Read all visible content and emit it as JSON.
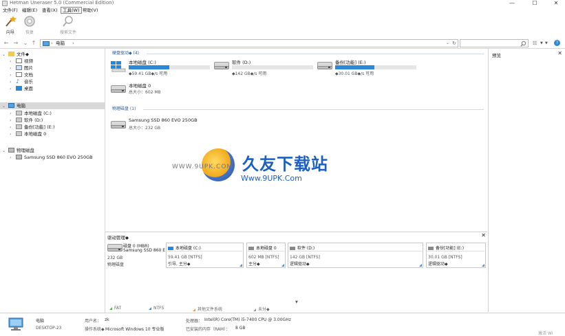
{
  "window": {
    "title": "Hetman Uneraser 5.0 (Commercial Edition)",
    "minimize": "—",
    "maximize": "☐",
    "close": "✕"
  },
  "menu": [
    {
      "label": "文件(F)"
    },
    {
      "label": "编辑(E)"
    },
    {
      "label": "查看(X)"
    },
    {
      "label": "工具(W)",
      "active": true
    },
    {
      "label": "帮助(V)"
    }
  ],
  "toolbar": {
    "wizard": "向导",
    "recover": "恢复",
    "search": "搜索文件"
  },
  "address": {
    "crumb": "电脑",
    "search_icon": "search-icon",
    "refresh": "↻"
  },
  "tree": {
    "files_root": "文件◆",
    "files": [
      "视频",
      "图片",
      "文档",
      "音乐",
      "桌面"
    ],
    "computer_root": "电脑",
    "computer": [
      "本地磁盘 (C:)",
      "软件 (D:)",
      "备份[功能] (E:)",
      "本地磁盘 0"
    ],
    "physical_root": "物理磁盘",
    "physical": [
      "Samsung SSD 860 EVO 250GB"
    ]
  },
  "main": {
    "logical_header": "硬盘驱动◆ (4)",
    "physical_header": "物理磁盘 (1)",
    "drives": [
      {
        "name": "本地磁盘 (C:)",
        "free": "◆59.41 GB◆/s 可用",
        "fill": 0.5
      },
      {
        "name": "软件 (D:)",
        "free": "◆142 GB◆/s 可用",
        "fill": 0.0
      },
      {
        "name": "备份[功能] (E:)",
        "free": "◆30.01 GB◆/s 可用",
        "fill": 0.48
      }
    ],
    "drive0": {
      "name": "本地磁盘 0",
      "size": "总大小：602 MB"
    },
    "physical": {
      "name": "Samsung SSD 860 EVO 250GB",
      "size": "总大小：232 GB"
    }
  },
  "watermark": {
    "big": "久友下载站",
    "url": "Www.9UPK.Com",
    "wurl": "WWW.9UPK.COM"
  },
  "preview": {
    "header": "预览",
    "close": "✕"
  },
  "diskmgmt": {
    "header": "驱动管理◆",
    "close": "✕",
    "disk": {
      "l1": "磁盘 0 (MBR)",
      "l2": "Samsung SSD 860 E",
      "l3": "232 GB",
      "l4": "物理磁盘"
    },
    "parts": [
      {
        "name": "本地磁盘 (C:)",
        "size": "59.41 GB [NTFS]",
        "type": "引导, 主分◆"
      },
      {
        "name": "本地磁盘 0",
        "size": "602 MB [NTFS]",
        "type": "主分◆"
      },
      {
        "name": "软件 (D:)",
        "size": "142 GB [NTFS]",
        "type": "逻辑驱动◆"
      },
      {
        "name": "备份[功能] (E:)",
        "size": "30.01 GB [NTFS]",
        "type": "逻辑驱动◆"
      }
    ],
    "legend": [
      "FAT",
      "NTFS",
      "其他文件系统",
      "未分◆"
    ]
  },
  "status": {
    "computer": "电脑",
    "host": "DESKTOP-23",
    "user_lbl": "用户名：",
    "user": "zk",
    "os_lbl": "操作系统◆",
    "os": "Microsoft Windows 10 专业版",
    "cpu_lbl": "处理器：",
    "cpu": "Intel(R) Core(TM) i5-7400 CPU @ 3.00GHz",
    "ram_lbl": "已安装的内存（RAM）：",
    "ram": "8 GB",
    "corner": "激活 Wi"
  },
  "colors": {
    "accent": "#2b87d8",
    "group_header": "#2c5e9a",
    "selected": "#d9d9d9"
  }
}
